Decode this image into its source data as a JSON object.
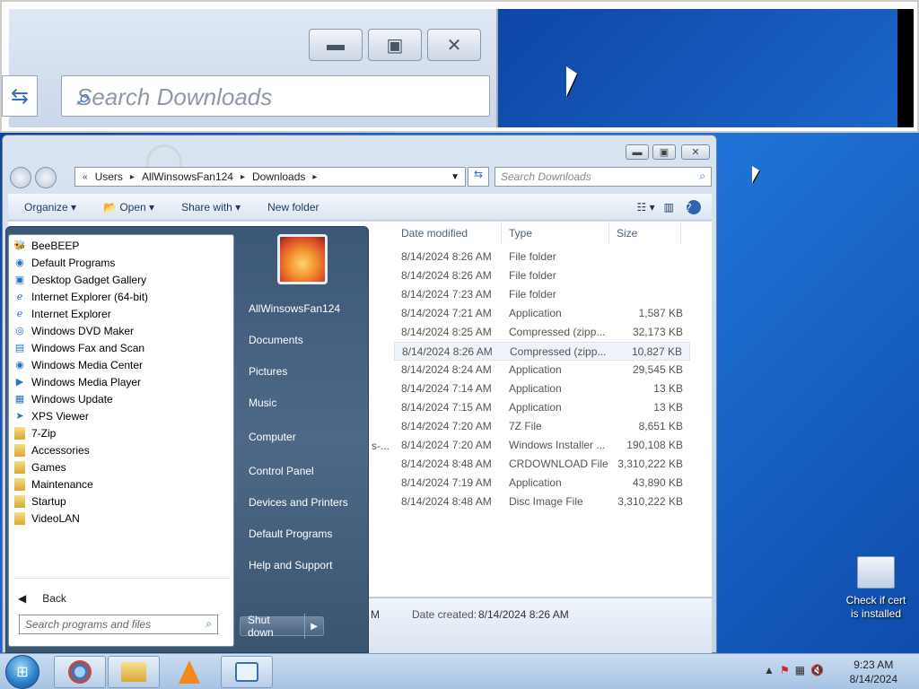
{
  "zoom": {
    "search_placeholder": "Search Downloads"
  },
  "explorer": {
    "breadcrumb": [
      "Users",
      "AllWinsowsFan124",
      "Downloads"
    ],
    "breadcrumb_prefix": "«",
    "search_placeholder": "Search Downloads",
    "toolbar": {
      "organize": "Organize",
      "open": "Open",
      "share_with": "Share with",
      "new_folder": "New folder"
    },
    "columns": {
      "date": "Date modified",
      "type": "Type",
      "size": "Size"
    },
    "rows": [
      {
        "date": "8/14/2024 8:26 AM",
        "type": "File folder",
        "size": ""
      },
      {
        "date": "8/14/2024 8:26 AM",
        "type": "File folder",
        "size": ""
      },
      {
        "date": "8/14/2024 7:23 AM",
        "type": "File folder",
        "size": ""
      },
      {
        "date": "8/14/2024 7:21 AM",
        "type": "Application",
        "size": "1,587 KB"
      },
      {
        "date": "8/14/2024 8:25 AM",
        "type": "Compressed (zipp...",
        "size": "32,173 KB"
      },
      {
        "date": "8/14/2024 8:26 AM",
        "type": "Compressed (zipp...",
        "size": "10,827 KB"
      },
      {
        "date": "8/14/2024 8:24 AM",
        "type": "Application",
        "size": "29,545 KB"
      },
      {
        "date": "8/14/2024 7:14 AM",
        "type": "Application",
        "size": "13 KB"
      },
      {
        "date": "8/14/2024 7:15 AM",
        "type": "Application",
        "size": "13 KB"
      },
      {
        "date": "8/14/2024 7:20 AM",
        "type": "7Z File",
        "size": "8,651 KB"
      },
      {
        "date": "8/14/2024 7:20 AM",
        "type": "Windows Installer ...",
        "size": "190,108 KB"
      },
      {
        "date": "8/14/2024 8:48 AM",
        "type": "CRDOWNLOAD File",
        "size": "3,310,222 KB"
      },
      {
        "date": "8/14/2024 7:19 AM",
        "type": "Application",
        "size": "43,890 KB"
      },
      {
        "date": "8/14/2024 8:48 AM",
        "type": "Disc Image File",
        "size": "3,310,222 KB"
      }
    ],
    "trunc_name": "s-...",
    "details_left": "M",
    "details_label": "Date created:",
    "details_value": "8/14/2024 8:26 AM"
  },
  "startmenu": {
    "programs": [
      "BeeBEEP",
      "Default Programs",
      "Desktop Gadget Gallery",
      "Internet Explorer (64-bit)",
      "Internet Explorer",
      "Windows DVD Maker",
      "Windows Fax and Scan",
      "Windows Media Center",
      "Windows Media Player",
      "Windows Update",
      "XPS Viewer",
      "7-Zip",
      "Accessories",
      "Games",
      "Maintenance",
      "Startup",
      "VideoLAN"
    ],
    "back": "Back",
    "search_placeholder": "Search programs and files",
    "right_links": [
      "AllWinsowsFan124",
      "Documents",
      "Pictures",
      "Music",
      "Computer",
      "Control Panel",
      "Devices and Printers",
      "Default Programs",
      "Help and Support"
    ],
    "shutdown": "Shut down"
  },
  "desktop": {
    "icon_label": "Check if cert is installed"
  },
  "taskbar": {
    "time": "9:23 AM",
    "date": "8/14/2024"
  }
}
